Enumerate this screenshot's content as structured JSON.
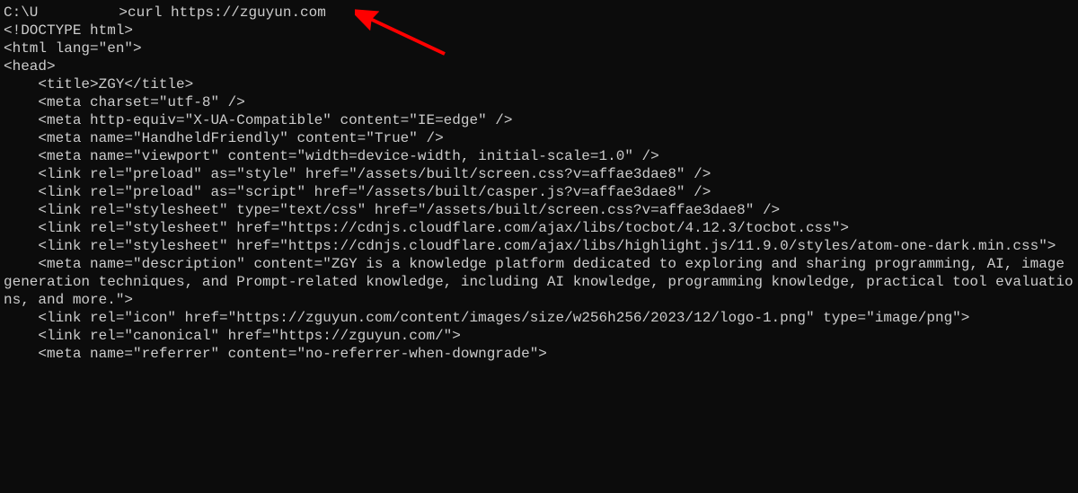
{
  "prompt": {
    "path_prefix": "C:\\U",
    "path_suffix": ">",
    "command": "curl https://zguyun.com"
  },
  "output": {
    "line1": "<!DOCTYPE html>",
    "line2": "<html lang=\"en\">",
    "line3": "<head>",
    "line4": "",
    "line5": "    <title>ZGY</title>",
    "line6": "    <meta charset=\"utf-8\" />",
    "line7": "    <meta http-equiv=\"X-UA-Compatible\" content=\"IE=edge\" />",
    "line8": "    <meta name=\"HandheldFriendly\" content=\"True\" />",
    "line9": "    <meta name=\"viewport\" content=\"width=device-width, initial-scale=1.0\" />",
    "line10": "",
    "line11": "    <link rel=\"preload\" as=\"style\" href=\"/assets/built/screen.css?v=affae3dae8\" />",
    "line12": "    <link rel=\"preload\" as=\"script\" href=\"/assets/built/casper.js?v=affae3dae8\" />",
    "line13": "",
    "line14": "    <link rel=\"stylesheet\" type=\"text/css\" href=\"/assets/built/screen.css?v=affae3dae8\" />",
    "line15": "",
    "line16": "    <link rel=\"stylesheet\" href=\"https://cdnjs.cloudflare.com/ajax/libs/tocbot/4.12.3/tocbot.css\">",
    "line17": "",
    "line18": "    <link rel=\"stylesheet\" href=\"https://cdnjs.cloudflare.com/ajax/libs/highlight.js/11.9.0/styles/atom-one-dark.min.css\">",
    "line19": "",
    "line20": "    <meta name=\"description\" content=\"ZGY is a knowledge platform dedicated to exploring and sharing programming, AI, image generation techniques, and Prompt-related knowledge, including AI knowledge, programming knowledge, practical tool evaluations, and more.\">",
    "line21": "    <link rel=\"icon\" href=\"https://zguyun.com/content/images/size/w256h256/2023/12/logo-1.png\" type=\"image/png\">",
    "line22": "    <link rel=\"canonical\" href=\"https://zguyun.com/\">",
    "line23": "    <meta name=\"referrer\" content=\"no-referrer-when-downgrade\">"
  },
  "annotation": {
    "color": "#ff0000"
  }
}
